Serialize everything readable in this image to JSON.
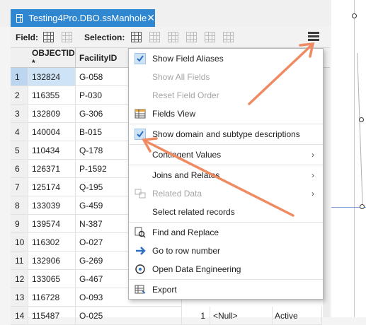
{
  "tab": {
    "title": "Testing4Pro.DBO.ssManhole",
    "close": "✕"
  },
  "toolbar": {
    "field_label": "Field:",
    "selection_label": "Selection:"
  },
  "table": {
    "headers": [
      "OBJECTID *",
      "FacilityID"
    ],
    "rows": [
      {
        "n": "1",
        "oid": "132824",
        "fac": "G-058"
      },
      {
        "n": "2",
        "oid": "116355",
        "fac": "P-030"
      },
      {
        "n": "3",
        "oid": "132809",
        "fac": "G-306"
      },
      {
        "n": "4",
        "oid": "140004",
        "fac": "B-015"
      },
      {
        "n": "5",
        "oid": "110434",
        "fac": "Q-178"
      },
      {
        "n": "6",
        "oid": "126371",
        "fac": "P-1592"
      },
      {
        "n": "7",
        "oid": "125174",
        "fac": "Q-195"
      },
      {
        "n": "8",
        "oid": "133039",
        "fac": "G-459"
      },
      {
        "n": "9",
        "oid": "139574",
        "fac": "N-387"
      },
      {
        "n": "10",
        "oid": "116302",
        "fac": "O-027"
      },
      {
        "n": "11",
        "oid": "132906",
        "fac": "G-269"
      },
      {
        "n": "12",
        "oid": "133065",
        "fac": "G-467"
      },
      {
        "n": "13",
        "oid": "116728",
        "fac": "O-093"
      },
      {
        "n": "14",
        "oid": "115487",
        "fac": "O-025",
        "x": "1",
        "null": "<Null>",
        "status": "Active"
      }
    ]
  },
  "menu": {
    "items": [
      {
        "label": "Show Field Aliases",
        "icon": "checkmark-icon",
        "checked": true,
        "disabled": false
      },
      {
        "label": "Show All Fields",
        "icon": "",
        "disabled": true
      },
      {
        "label": "Reset Field Order",
        "icon": "",
        "disabled": true
      },
      {
        "label": "Fields View",
        "icon": "fields-view-icon",
        "disabled": false
      },
      {
        "label": "Show domain and subtype descriptions",
        "icon": "checkmark-icon",
        "checked": true,
        "disabled": false
      },
      {
        "label": "Contingent Values",
        "icon": "",
        "disabled": false,
        "submenu": true
      },
      {
        "label": "Joins and Relates",
        "icon": "",
        "disabled": false,
        "submenu": true
      },
      {
        "label": "Related Data",
        "icon": "related-data-icon",
        "disabled": true,
        "submenu": true
      },
      {
        "label": "Select related records",
        "icon": "",
        "disabled": false
      },
      {
        "label": "Find and Replace",
        "icon": "find-replace-icon",
        "disabled": false
      },
      {
        "label": "Go to row number",
        "icon": "arrow-right-icon",
        "disabled": false
      },
      {
        "label": "Open Data Engineering",
        "icon": "data-engineering-icon",
        "disabled": false
      },
      {
        "label": "Export",
        "icon": "export-table-icon",
        "disabled": false
      }
    ],
    "arrow_glyph": "›"
  },
  "colors": {
    "tab_active": "#2f87d1",
    "selection": "#cfe3f6",
    "annotation_arrow": "#ef8a62",
    "check": "#2e6fc0"
  }
}
